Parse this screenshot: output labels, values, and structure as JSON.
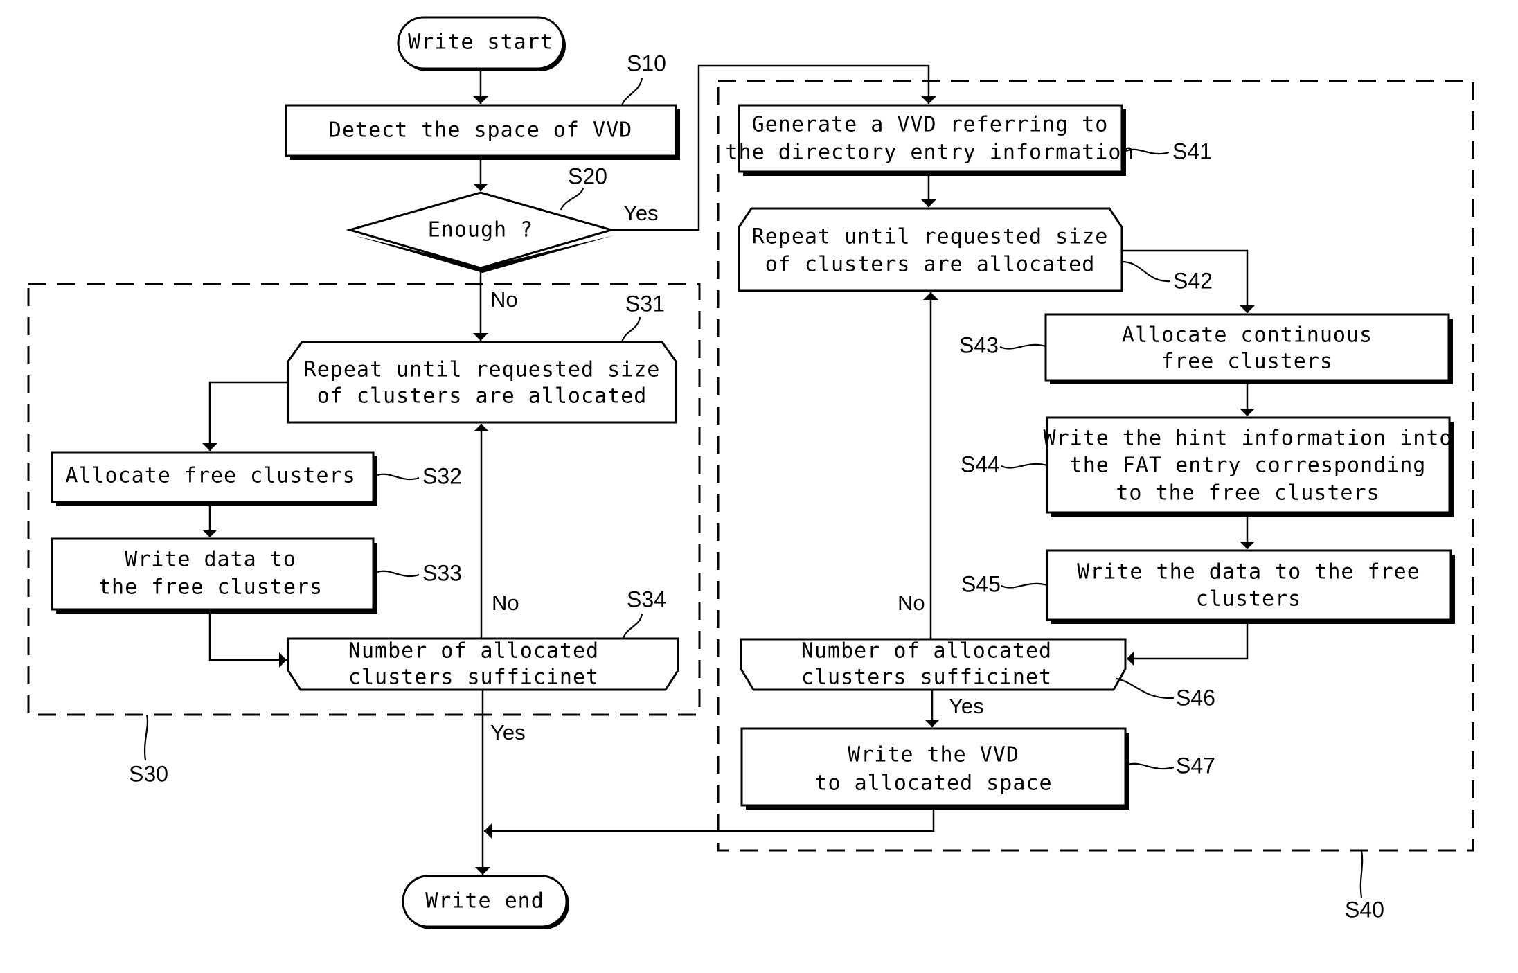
{
  "diagram": {
    "terminals": {
      "start": "Write start",
      "end": "Write end"
    },
    "steps": {
      "S10": {
        "ref": "S10",
        "lines": [
          "Detect the space of VVD"
        ]
      },
      "S20": {
        "ref": "S20",
        "lines": [
          "Enough ?"
        ]
      },
      "S30": {
        "ref": "S30"
      },
      "S31": {
        "ref": "S31",
        "lines": [
          "Repeat until requested size",
          "of clusters are allocated"
        ]
      },
      "S32": {
        "ref": "S32",
        "lines": [
          "Allocate free clusters"
        ]
      },
      "S33": {
        "ref": "S33",
        "lines": [
          "Write data to",
          "the free clusters"
        ]
      },
      "S34": {
        "ref": "S34",
        "lines": [
          "Number of allocated",
          "clusters sufficinet"
        ]
      },
      "S40": {
        "ref": "S40"
      },
      "S41": {
        "ref": "S41",
        "lines": [
          "Generate a VVD referring to",
          "the directory entry information"
        ]
      },
      "S42": {
        "ref": "S42",
        "lines": [
          "Repeat until requested size",
          "of clusters are allocated"
        ]
      },
      "S43": {
        "ref": "S43",
        "lines": [
          "Allocate continuous",
          "free clusters"
        ]
      },
      "S44": {
        "ref": "S44",
        "lines": [
          "Write the hint information into",
          "the FAT entry corresponding",
          "to the free clusters"
        ]
      },
      "S45": {
        "ref": "S45",
        "lines": [
          "Write the data to the free",
          "clusters"
        ]
      },
      "S46": {
        "ref": "S46",
        "lines": [
          "Number of allocated",
          "clusters sufficinet"
        ]
      },
      "S47": {
        "ref": "S47",
        "lines": [
          "Write the VVD",
          "to allocated space"
        ]
      }
    },
    "edge_labels": {
      "s20_yes": "Yes",
      "s20_no": "No",
      "s34_no": "No",
      "s34_yes": "Yes",
      "s46_no": "No",
      "s46_yes": "Yes"
    }
  }
}
